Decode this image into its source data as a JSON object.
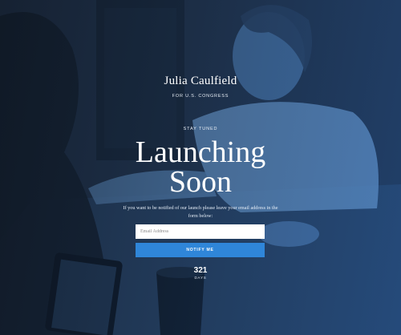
{
  "brand": {
    "name": "Julia Caulfield",
    "subtitle": "FOR U.S. CONGRESS"
  },
  "hero": {
    "kicker": "STAY TUNED",
    "headline_line1": "Launching",
    "headline_line2": "Soon",
    "description": "If you want to be notified of our launch please leave your email address in the form below:"
  },
  "form": {
    "email_placeholder": "Email Address",
    "email_value": "",
    "submit_label": "NOTIFY ME"
  },
  "countdown": {
    "value": "321",
    "unit": "DAYS"
  },
  "colors": {
    "accent": "#2f86d9",
    "overlay_dark": "#1e2a3a",
    "overlay_blue": "#3a86d6"
  }
}
